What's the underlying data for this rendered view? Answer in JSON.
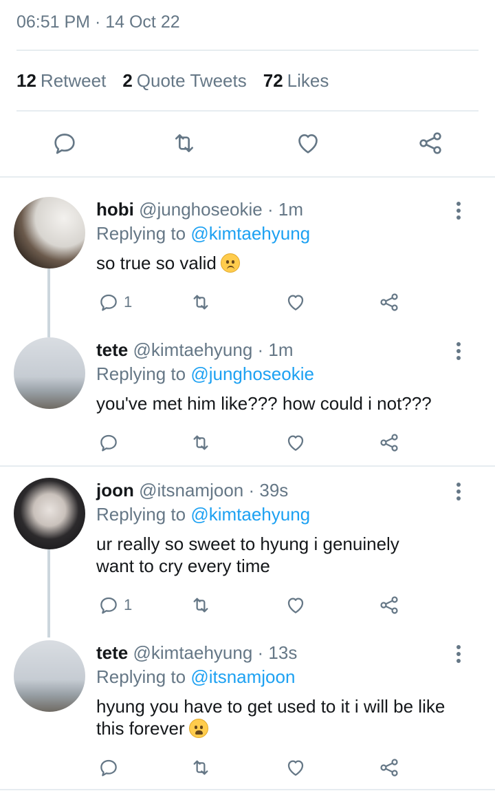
{
  "header": {
    "timestamp": "06:51 PM · 14 Oct 22"
  },
  "stats": {
    "retweets_count": "12",
    "retweets_label": "Retweet",
    "quotes_count": "2",
    "quotes_label": "Quote Tweets",
    "likes_count": "72",
    "likes_label": "Likes"
  },
  "colors": {
    "accent": "#1da1f2",
    "muted": "#657786",
    "text": "#14171a",
    "divider": "#e6ecf0"
  },
  "replies": [
    {
      "name": "hobi",
      "handle": "@junghoseokie",
      "time": "· 1m",
      "replying_prefix": "Replying to",
      "replying_to": "@kimtaehyung",
      "text": "so true so valid",
      "emoji": "pleading-face-emoji",
      "reply_count": "1"
    },
    {
      "name": "tete",
      "handle": "@kimtaehyung",
      "time": "· 1m",
      "replying_prefix": "Replying to",
      "replying_to": "@junghoseokie",
      "text": "you've met him like??? how could i not???",
      "reply_count": ""
    },
    {
      "name": "joon",
      "handle": "@itsnamjoon",
      "time": "· 39s",
      "replying_prefix": "Replying to",
      "replying_to": "@kimtaehyung",
      "text": "ur really so sweet to hyung i genuinely want to cry every time",
      "reply_count": "1"
    },
    {
      "name": "tete",
      "handle": "@kimtaehyung",
      "time": "· 13s",
      "replying_prefix": "Replying to",
      "replying_to": "@itsnamjoon",
      "text": "hyung you have to get used to it i will be like this forever",
      "emoji": "weary-face-emoji",
      "reply_count": ""
    }
  ],
  "icons": [
    "reply-icon",
    "retweet-icon",
    "like-icon",
    "share-icon",
    "more-icon"
  ]
}
